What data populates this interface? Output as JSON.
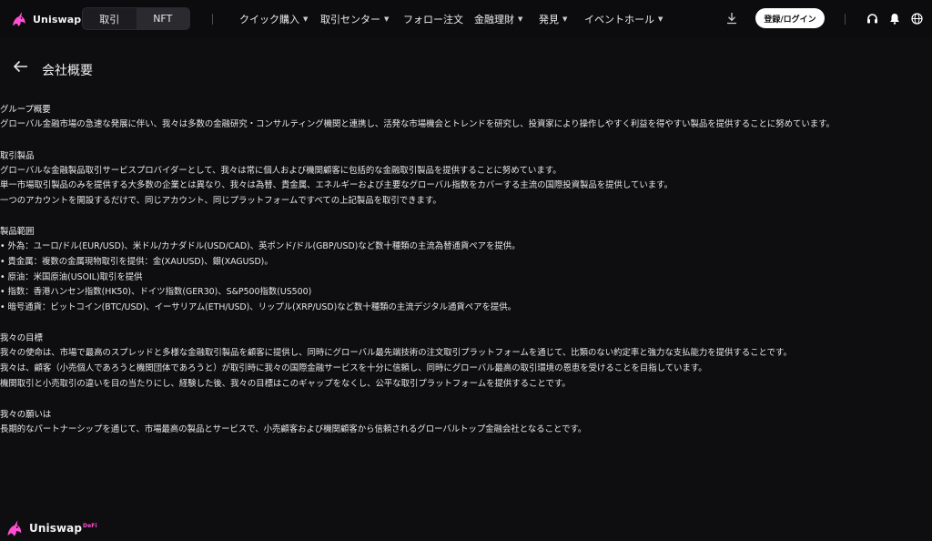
{
  "brand": {
    "name": "Uniswap",
    "suffix": "DeFi"
  },
  "mode_tabs": [
    "取引",
    "NFT"
  ],
  "nav": [
    {
      "label": "クイック購入",
      "dropdown": true
    },
    {
      "label": "取引センター",
      "dropdown": true
    },
    {
      "label": "フォロー注文",
      "dropdown": false
    },
    {
      "label": "金融理財",
      "dropdown": true
    },
    {
      "label": "発見",
      "dropdown": true
    },
    {
      "label": "イベントホール",
      "dropdown": true
    }
  ],
  "login_label": "登録/ログイン",
  "icons": [
    "download-icon",
    "headset-icon",
    "bell-icon",
    "globe-icon",
    "back-arrow-icon"
  ],
  "page_title": "会社概要",
  "sections": [
    {
      "title": "グループ概要",
      "lines": [
        "グローバル金融市場の急速な発展に伴い、我々は多数の金融研究・コンサルティング機関と連携し、活発な市場機会とトレンドを研究し、投資家により操作しやすく利益を得やすい製品を提供することに努めています。"
      ]
    },
    {
      "title": "取引製品",
      "lines": [
        "グローバルな金融製品取引サービスプロバイダーとして、我々は常に個人および機関顧客に包括的な金融取引製品を提供することに努めています。",
        "単一市場取引製品のみを提供する大多数の企業とは異なり、我々は為替、貴金属、エネルギーおよび主要なグローバル指数をカバーする主流の国際投資製品を提供しています。",
        "一つのアカウントを開設するだけで、同じアカウント、同じプラットフォームですべての上記製品を取引できます。"
      ]
    },
    {
      "title": "製品範囲",
      "lines": [
        "• 外為：ユーロ/ドル(EUR/USD)、米ドル/カナダドル(USD/CAD)、英ポンド/ドル(GBP/USD)など数十種類の主流為替通貨ペアを提供。",
        "• 貴金属：複数の金属現物取引を提供：金(XAUUSD)、銀(XAGUSD)。",
        "• 原油：米国原油(USOIL)取引を提供",
        "• 指数：香港ハンセン指数(HK50)、ドイツ指数(GER30)、S&P500指数(US500)",
        "• 暗号通貨：ビットコイン(BTC/USD)、イーサリアム(ETH/USD)、リップル(XRP/USD)など数十種類の主流デジタル通貨ペアを提供。"
      ]
    },
    {
      "title": "我々の目標",
      "lines": [
        "我々の使命は、市場で最高のスプレッドと多様な金融取引製品を顧客に提供し、同時にグローバル最先端技術の注文取引プラットフォームを通じて、比類のない約定率と強力な支払能力を提供することです。",
        "我々は、顧客（小売個人であろうと機関団体であろうと）が取引時に我々の国際金融サービスを十分に信頼し、同時にグローバル最高の取引環境の恩恵を受けることを目指しています。",
        "機関取引と小売取引の違いを目の当たりにし、経験した後、我々の目標はこのギャップをなくし、公平な取引プラットフォームを提供することです。"
      ]
    },
    {
      "title": "我々の願いは",
      "lines": [
        "長期的なパートナーシップを通じて、市場最高の製品とサービスで、小売顧客および機関顧客から信頼されるグローバルトップ金融会社となることです。"
      ]
    }
  ],
  "colors": {
    "accent": "#ff4fd3",
    "background": "#0e0e10",
    "text": "#e6e6e6"
  }
}
